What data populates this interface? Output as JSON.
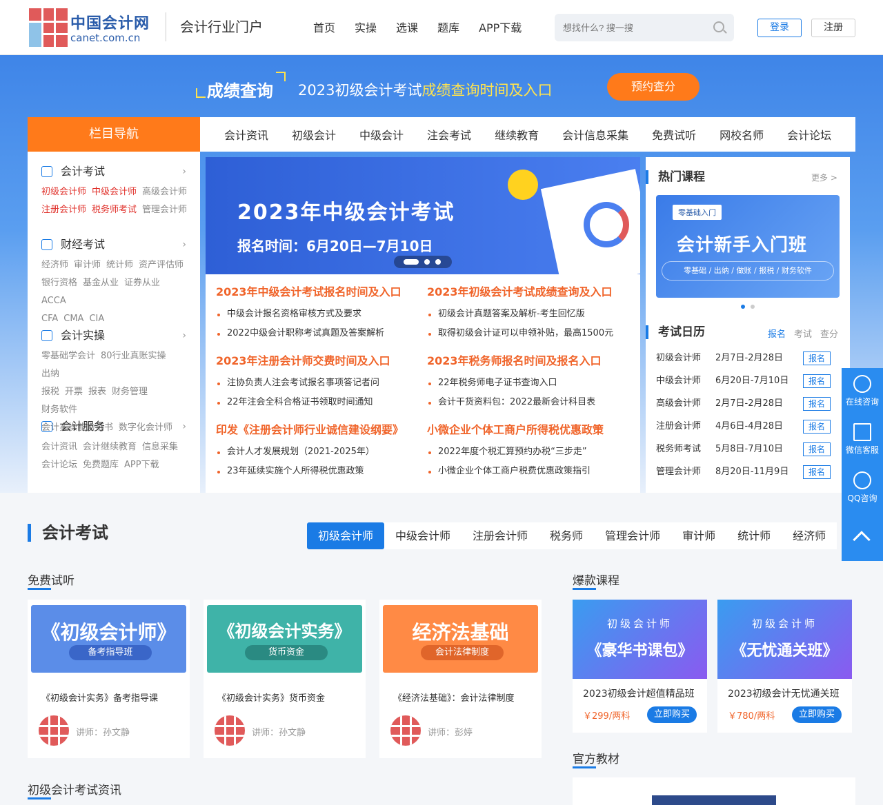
{
  "header": {
    "logo_cn": "中国会计网",
    "logo_en": "canet.com.cn",
    "portal": "会计行业门户",
    "nav": [
      "首页",
      "实操",
      "选课",
      "题库",
      "APP下载"
    ],
    "search_placeholder": "想找什么? 搜一搜",
    "login": "登录",
    "register": "注册"
  },
  "banner": {
    "title": "成绩查询",
    "sub_pre": "2023初级会计考试",
    "sub_hl": "成绩查询时间及入口",
    "button": "预约查分"
  },
  "nav_head": "栏目导航",
  "subnav": [
    "会计资讯",
    "初级会计",
    "中级会计",
    "注会考试",
    "继续教育",
    "会计信息采集",
    "免费试听",
    "网校名师",
    "会计论坛"
  ],
  "categories": [
    {
      "title": "会计考试",
      "lines": [
        [
          {
            "t": "初级会计师",
            "red": true
          },
          {
            "t": "中级会计师",
            "red": true
          },
          {
            "t": "高级会计师",
            "red": false
          }
        ],
        [
          {
            "t": "注册会计师",
            "red": true
          },
          {
            "t": "税务师考试",
            "red": true
          },
          {
            "t": "管理会计师",
            "red": false
          }
        ]
      ]
    },
    {
      "title": "财经考试",
      "lines": [
        [
          {
            "t": "经济师"
          },
          {
            "t": "审计师"
          },
          {
            "t": "统计师"
          },
          {
            "t": "资产评估师"
          }
        ],
        [
          {
            "t": "银行资格"
          },
          {
            "t": "基金从业"
          },
          {
            "t": "证券从业"
          },
          {
            "t": "ACCA"
          }
        ],
        [
          {
            "t": "CFA"
          },
          {
            "t": "CMA"
          },
          {
            "t": "CIA"
          }
        ]
      ]
    },
    {
      "title": "会计实操",
      "lines": [
        [
          {
            "t": "零基础学会计"
          },
          {
            "t": "80行业真账实操"
          },
          {
            "t": "出纳"
          }
        ],
        [
          {
            "t": "报税"
          },
          {
            "t": "开票"
          },
          {
            "t": "报表"
          },
          {
            "t": "财务管理"
          },
          {
            "t": "财务软件"
          }
        ],
        [
          {
            "t": "会计实操能力证书"
          },
          {
            "t": "数字化会计师"
          }
        ]
      ]
    },
    {
      "title": "会计服务",
      "lines": [
        [
          {
            "t": "会计资讯"
          },
          {
            "t": "会计继续教育"
          },
          {
            "t": "信息采集"
          }
        ],
        [
          {
            "t": "会计论坛"
          },
          {
            "t": "免费题库"
          },
          {
            "t": "APP下载"
          }
        ]
      ]
    }
  ],
  "slide": {
    "title": "2023年中级会计考试",
    "sub": "报名时间：6月20日—7月10日"
  },
  "news": [
    {
      "h": "2023年中级会计考试报名时间及入口",
      "items": [
        "中级会计报名资格审核方式及要求",
        "2022中级会计职称考试真题及答案解析"
      ]
    },
    {
      "h": "2023年初级会计考试成绩查询及入口",
      "items": [
        "初级会计真题答案及解析-考生回忆版",
        "取得初级会计证可以申领补贴，最高1500元"
      ]
    },
    {
      "h": "2023年注册会计师交费时间及入口",
      "items": [
        "注协负责人注会考试报名事项答记者问",
        "22年注会全科合格证书领取时间通知"
      ]
    },
    {
      "h": "2023年税务师报名时间及报名入口",
      "items": [
        "22年税务师电子证书查询入口",
        "会计干货资料包：2022最新会计科目表"
      ]
    },
    {
      "h": "印发《注册会计师行业诚信建设纲要》",
      "items": [
        "会计人才发展规划（2021-2025年）",
        "23年延续实施个人所得税优惠政策"
      ]
    },
    {
      "h": "小微企业个体工商户所得税优惠政策",
      "items": [
        "2022年度个税汇算预约办税“三步走”",
        "小微企业个体工商户税费优惠政策指引"
      ]
    }
  ],
  "hot": {
    "title": "热门课程",
    "more": "更多 >",
    "tag": "零基础入门",
    "card_title": "会计新手入门班",
    "card_sub": "零基础 / 出纳 / 做账 / 报税 / 财务软件"
  },
  "calendar": {
    "title": "考试日历",
    "tabs": [
      "报名",
      "考试",
      "查分"
    ],
    "rows": [
      {
        "name": "初级会计师",
        "date": "2月7日-2月28日",
        "btn": "报名"
      },
      {
        "name": "中级会计师",
        "date": "6月20日-7月10日",
        "btn": "报名"
      },
      {
        "name": "高级会计师",
        "date": "2月7日-2月28日",
        "btn": "报名"
      },
      {
        "name": "注册会计师",
        "date": "4月6日-4月28日",
        "btn": "报名"
      },
      {
        "name": "税务师考试",
        "date": "5月8日-7月10日",
        "btn": "报名"
      },
      {
        "name": "管理会计师",
        "date": "8月20日-11月9日",
        "btn": "报名"
      }
    ]
  },
  "float": [
    "在线咨询",
    "微信客服",
    "QQ咨询"
  ],
  "section": {
    "title": "会计考试",
    "tabs": [
      "初级会计师",
      "中级会计师",
      "注册会计师",
      "税务师",
      "管理会计师",
      "审计师",
      "统计师",
      "经济师"
    ],
    "free": "免费试听",
    "hot": "爆款课程",
    "books": "官方教材",
    "news": "初级会计考试资讯"
  },
  "trials": [
    {
      "big": "《初级会计师》",
      "tag": "备考指导班",
      "name": "《初级会计实务》备考指导课",
      "teacher": "讲师：孙文静",
      "color": "#5b8de8",
      "tagc": "#3a66c8"
    },
    {
      "big": "《初级会计实务》",
      "tag": "货币资金",
      "name": "《初级会计实务》货币资金",
      "teacher": "讲师：孙文静",
      "color": "#3fb3a8",
      "tagc": "#2a8a82"
    },
    {
      "big": "经济法基础",
      "tag": "会计法律制度",
      "name": "《经济法基础》：会计法律制度",
      "teacher": "讲师：彭婷",
      "color": "#ff8a45",
      "tagc": "#e0652a"
    }
  ],
  "hot_courses": [
    {
      "small": "初级会计师",
      "big": "《豪华书课包》",
      "name": "2023初级会计超值精品班",
      "price": "￥299/两科",
      "buy": "立即购买"
    },
    {
      "small": "初级会计师",
      "big": "《无忧通关班》",
      "name": "2023初级会计无忧通关班",
      "price": "￥780/两科",
      "buy": "立即购买"
    }
  ]
}
